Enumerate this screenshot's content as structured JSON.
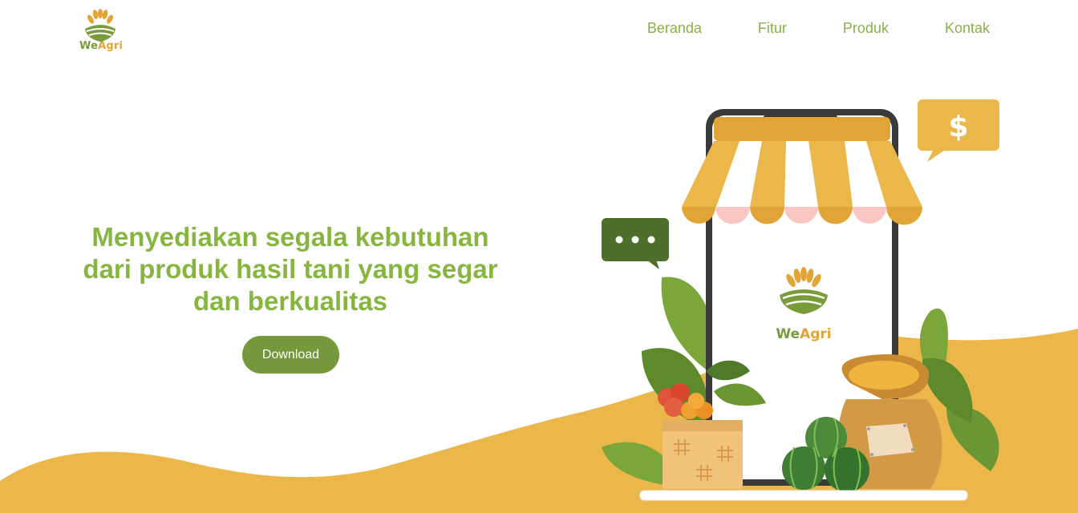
{
  "brand": {
    "name_part1": "We",
    "name_part2": "Agri"
  },
  "nav": {
    "items": [
      "Beranda",
      "Fitur",
      "Produk",
      "Kontak"
    ]
  },
  "hero": {
    "title": "Menyediakan segala kebutuhan dari produk hasil tani yang segar dan berkualitas",
    "button_label": "Download"
  },
  "illustration": {
    "phone_logo_part1": "We",
    "phone_logo_part2": "Agri",
    "price_bubble": "$",
    "chat_bubble": "•••",
    "icons": [
      "wheat-logo-icon",
      "shop-awning-icon",
      "dollar-bubble-icon",
      "chat-dots-icon",
      "vegetable-basket-icon",
      "grain-sack-icon",
      "watermelon-icon",
      "leaf-icon"
    ]
  },
  "colors": {
    "accent_green": "#87b640",
    "dark_green": "#74983a",
    "brand_yellow": "#ebb64a"
  }
}
